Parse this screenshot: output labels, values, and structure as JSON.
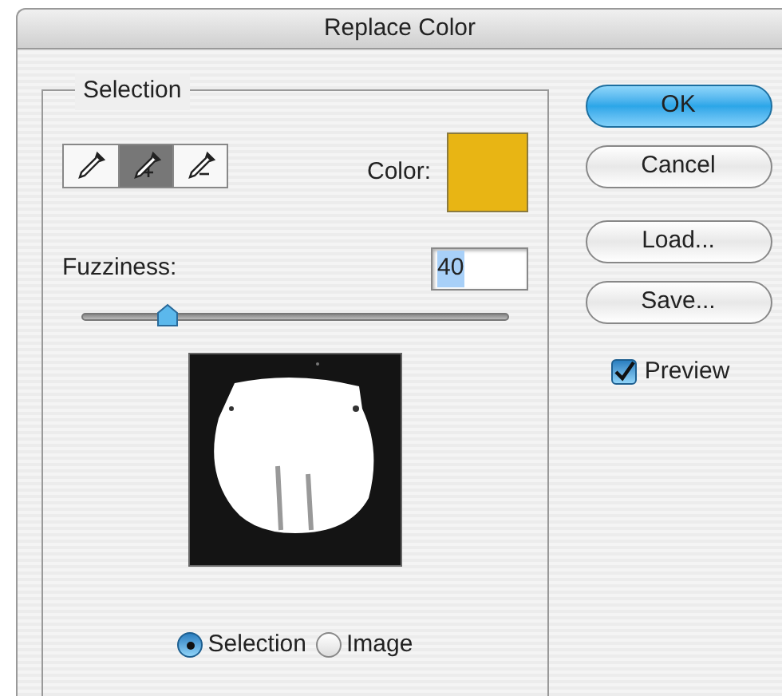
{
  "window": {
    "title": "Replace Color"
  },
  "selection_group": {
    "title": "Selection",
    "tools": [
      {
        "kind": "eyedropper",
        "selected": false
      },
      {
        "kind": "eyedropper-plus",
        "selected": true
      },
      {
        "kind": "eyedropper-minus",
        "selected": false
      }
    ],
    "color_label": "Color:",
    "color": "#e8b514",
    "fuzziness": {
      "label": "Fuzziness:",
      "value": "40",
      "level": 0.2
    },
    "view_options": [
      {
        "label": "Selection",
        "selected": true
      },
      {
        "label": "Image",
        "selected": false
      }
    ]
  },
  "buttons": [
    {
      "label": "OK",
      "default": true
    },
    {
      "label": "Cancel",
      "default": false
    },
    {
      "label": "Load...",
      "default": false
    },
    {
      "label": "Save...",
      "default": false
    }
  ],
  "preview_checkbox": {
    "label": "Preview",
    "checked": true
  }
}
